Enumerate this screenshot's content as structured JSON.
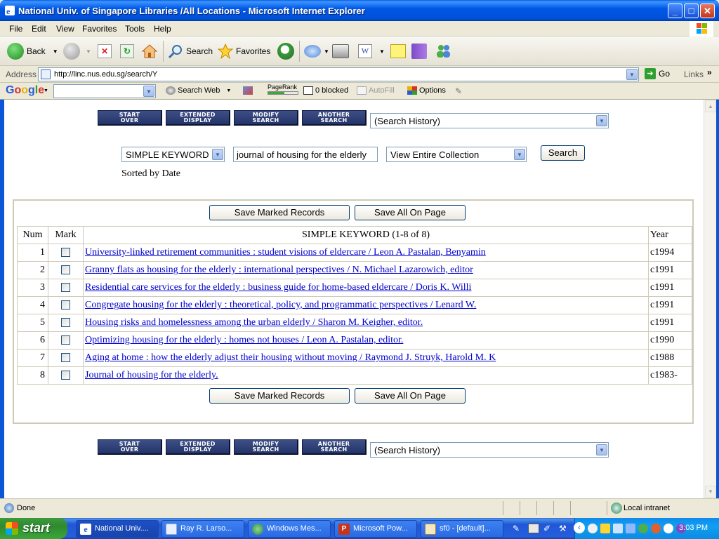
{
  "window": {
    "title": "National Univ. of Singapore Libraries /All Locations - Microsoft Internet Explorer",
    "min_glyph": "_",
    "max_glyph": "□",
    "close_glyph": "✕"
  },
  "menu": [
    "File",
    "Edit",
    "View",
    "Favorites",
    "Tools",
    "Help"
  ],
  "toolbar": {
    "back": "Back",
    "search": "Search",
    "favorites": "Favorites"
  },
  "address": {
    "label": "Address",
    "url": "http://linc.nus.edu.sg/search/Y",
    "go": "Go",
    "links": "Links",
    "chevron": "»"
  },
  "google_bar": {
    "logo": "Google",
    "search_web": "Search Web",
    "pagerank": "PageRank",
    "blocked": "0 blocked",
    "autofill": "AutoFill",
    "options": "Options"
  },
  "page": {
    "nav_buttons": [
      {
        "line1": "START",
        "line2": "OVER"
      },
      {
        "line1": "EXTENDED",
        "line2": "DISPLAY"
      },
      {
        "line1": "MODIFY",
        "line2": "SEARCH"
      },
      {
        "line1": "ANOTHER",
        "line2": "SEARCH"
      }
    ],
    "search_history": "(Search History)",
    "search_type": "SIMPLE KEYWORD",
    "search_query": "journal of housing for the elderly",
    "collection": "View Entire Collection",
    "search_button": "Search",
    "sorted_by": "Sorted by Date",
    "save_marked": "Save Marked Records",
    "save_all": "Save All On Page",
    "table": {
      "headers": {
        "num": "Num",
        "mark": "Mark",
        "title": "SIMPLE KEYWORD (1-8 of 8)",
        "year": "Year"
      },
      "rows": [
        {
          "num": "1",
          "title": "University-linked retirement communities : student visions of eldercare / Leon A. Pastalan, Benyamin",
          "year": "c1994"
        },
        {
          "num": "2",
          "title": "Granny flats as housing for the elderly : international perspectives / N. Michael Lazarowich, editor",
          "year": "c1991"
        },
        {
          "num": "3",
          "title": "Residential care services for the elderly : business guide for home-based eldercare / Doris K. Willi",
          "year": "c1991"
        },
        {
          "num": "4",
          "title": "Congregate housing for the elderly : theoretical, policy, and programmatic perspectives / Lenard W.",
          "year": "c1991"
        },
        {
          "num": "5",
          "title": "Housing risks and homelessness among the urban elderly / Sharon M. Keigher, editor.",
          "year": "c1991"
        },
        {
          "num": "6",
          "title": "Optimizing housing for the elderly : homes not houses / Leon A. Pastalan, editor.",
          "year": "c1990"
        },
        {
          "num": "7",
          "title": "Aging at home : how the elderly adjust their housing without moving / Raymond J. Struyk, Harold M. K",
          "year": "c1988"
        },
        {
          "num": "8",
          "title": "Journal of housing for the elderly.",
          "year": "c1983-"
        }
      ]
    }
  },
  "status": {
    "text": "Done",
    "zone": "Local intranet"
  },
  "taskbar": {
    "start": "start",
    "tasks": [
      "National Univ....",
      "Ray R. Larso...",
      "Windows Mes...",
      "Microsoft Pow...",
      "sf0 - [default]..."
    ],
    "clock": "3:03 PM"
  }
}
